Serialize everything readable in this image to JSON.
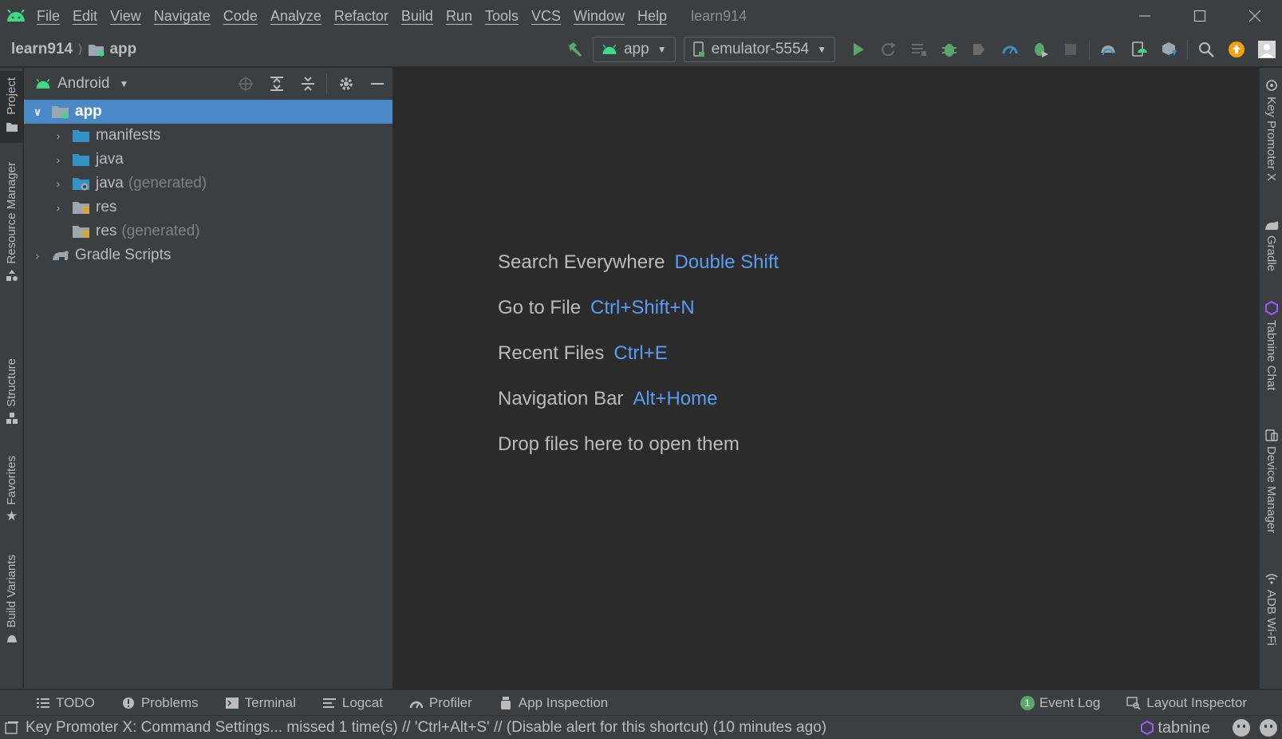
{
  "menu": {
    "items": [
      "File",
      "Edit",
      "View",
      "Navigate",
      "Code",
      "Analyze",
      "Refactor",
      "Build",
      "Run",
      "Tools",
      "VCS",
      "Window",
      "Help"
    ],
    "project_title": "learn914",
    "window_controls": [
      "minimize",
      "maximize",
      "close"
    ]
  },
  "toolbar": {
    "breadcrumb": {
      "project": "learn914",
      "module": "app"
    },
    "run_config": "app",
    "device": "emulator-5554",
    "icons": [
      "hammer-icon",
      "run-icon",
      "apply-changes-icon",
      "apply-code-changes-icon",
      "debug-icon",
      "profile-icon",
      "attach-debugger-icon",
      "stop-icon",
      "sync-gradle-icon",
      "avd-manager-icon",
      "sdk-manager-icon",
      "search-icon",
      "update-icon",
      "user-icon"
    ]
  },
  "left_strip": {
    "tabs": [
      "Project",
      "Resource Manager",
      "Structure",
      "Favorites",
      "Build Variants"
    ]
  },
  "right_strip": {
    "tabs": [
      "Key Promoter X",
      "Gradle",
      "Tabnine Chat",
      "Device Manager",
      "ADB Wi-Fi"
    ]
  },
  "project_panel": {
    "view_mode": "Android",
    "tree": [
      {
        "label": "app",
        "suffix": "",
        "level": 0,
        "expanded": true,
        "selected": true,
        "icon": "module-icon"
      },
      {
        "label": "manifests",
        "suffix": "",
        "level": 1,
        "expanded": false,
        "selected": false,
        "icon": "folder-icon"
      },
      {
        "label": "java",
        "suffix": "",
        "level": 1,
        "expanded": false,
        "selected": false,
        "icon": "folder-icon"
      },
      {
        "label": "java",
        "suffix": "(generated)",
        "level": 1,
        "expanded": false,
        "selected": false,
        "icon": "generated-folder-icon"
      },
      {
        "label": "res",
        "suffix": "",
        "level": 1,
        "expanded": false,
        "selected": false,
        "icon": "resources-folder-icon"
      },
      {
        "label": "res",
        "suffix": "(generated)",
        "level": 1,
        "expanded": null,
        "selected": false,
        "icon": "resources-folder-icon"
      },
      {
        "label": "Gradle Scripts",
        "suffix": "",
        "level": 0,
        "expanded": false,
        "selected": false,
        "icon": "gradle-icon"
      }
    ]
  },
  "editor": {
    "hints": [
      {
        "label": "Search Everywhere",
        "shortcut": "Double Shift"
      },
      {
        "label": "Go to File",
        "shortcut": "Ctrl+Shift+N"
      },
      {
        "label": "Recent Files",
        "shortcut": "Ctrl+E"
      },
      {
        "label": "Navigation Bar",
        "shortcut": "Alt+Home"
      },
      {
        "label": "Drop files here to open them",
        "shortcut": ""
      }
    ]
  },
  "bottom_bar": {
    "left": [
      "TODO",
      "Problems",
      "Terminal",
      "Logcat",
      "Profiler",
      "App Inspection"
    ],
    "event_log": "Event Log",
    "event_count": "1",
    "layout_inspector": "Layout Inspector"
  },
  "status_bar": {
    "message": "Key Promoter X: Command Settings... missed 1 time(s) // 'Ctrl+Alt+S' // (Disable alert for this shortcut) (10 minutes ago)",
    "tabnine": "tabnine"
  },
  "colors": {
    "selection": "#4a88c7",
    "shortcut": "#589df6",
    "android_green": "#3ddc84",
    "run_green": "#59a869",
    "folder_blue": "#3592c4"
  }
}
